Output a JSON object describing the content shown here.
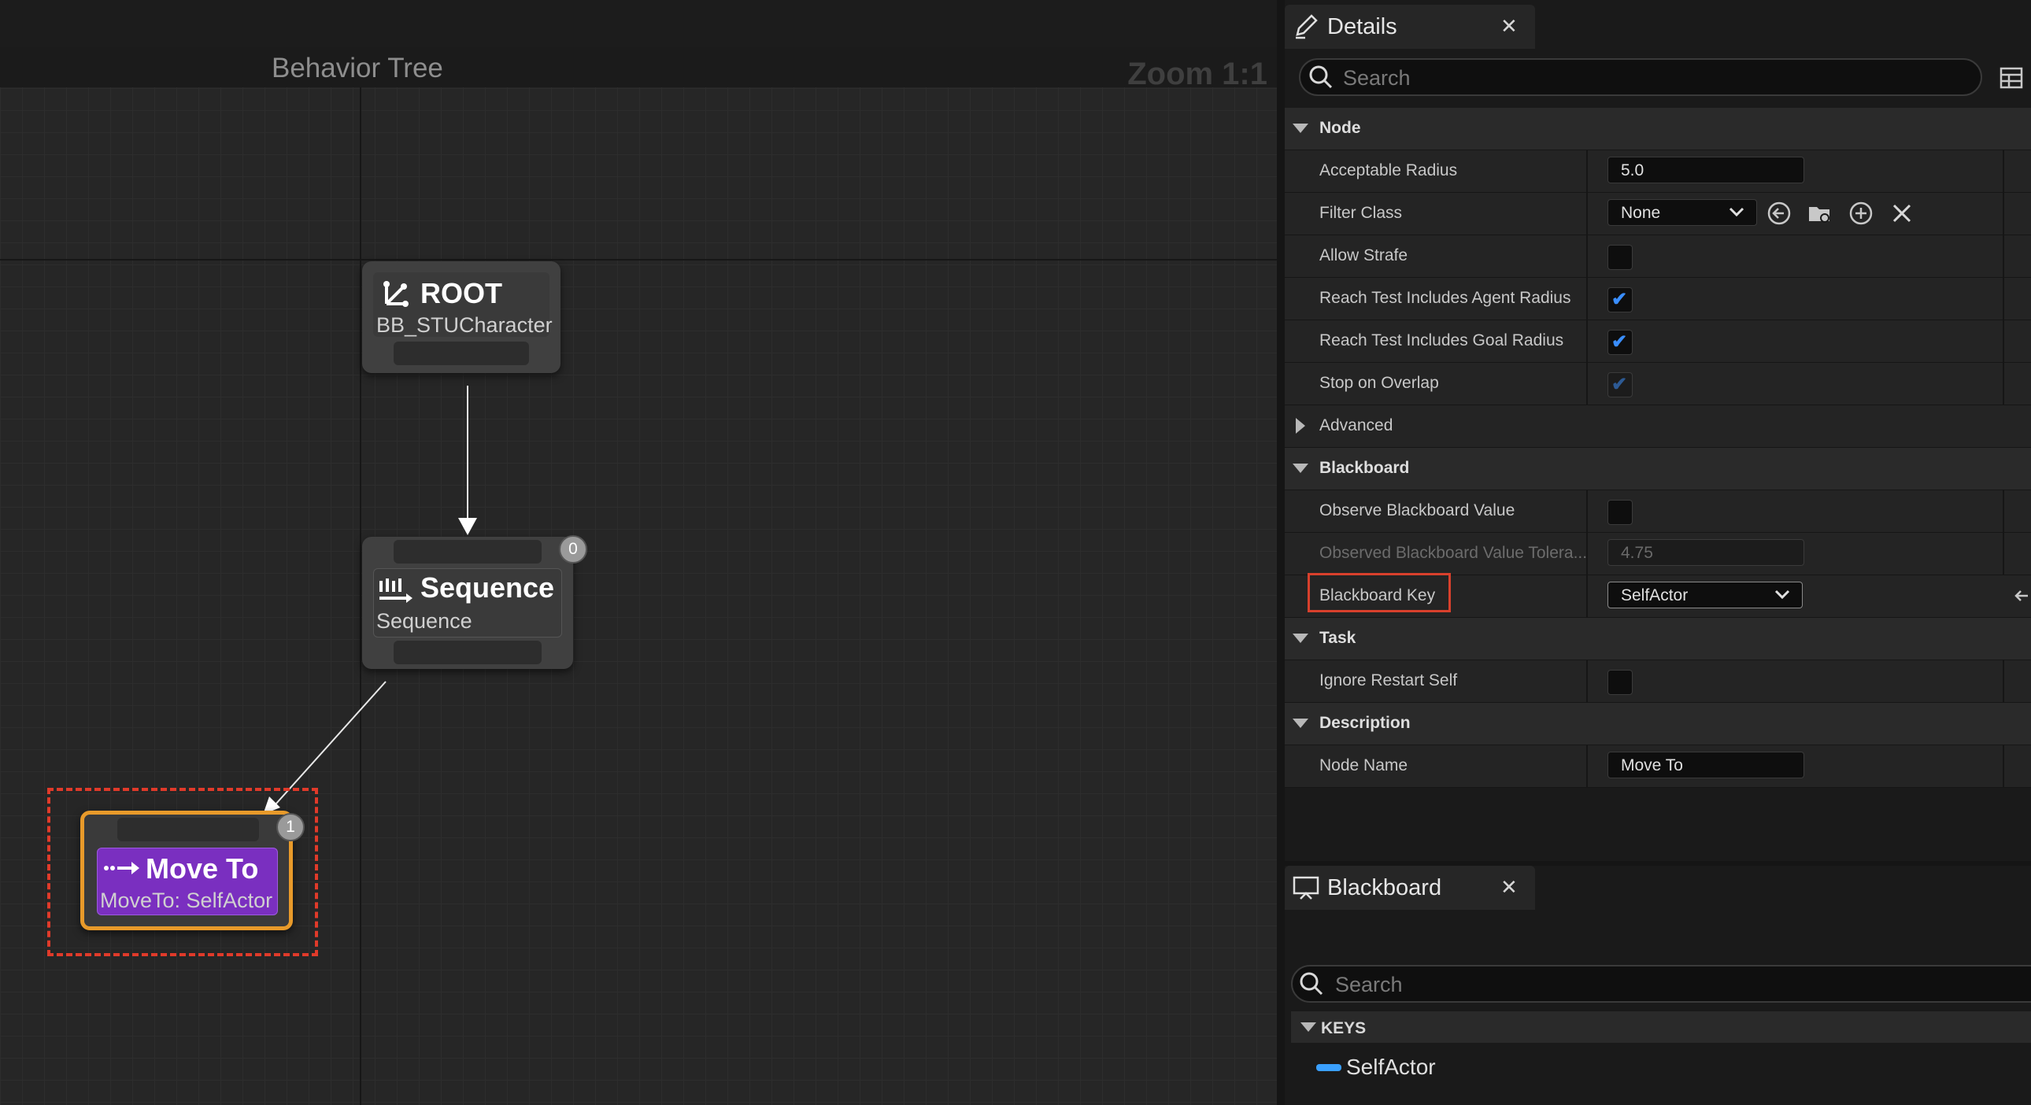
{
  "graph": {
    "title": "Behavior Tree",
    "zoom": "Zoom 1:1",
    "nodes": {
      "root": {
        "title": "ROOT",
        "subtitle": "BB_STUCharacter"
      },
      "sequence": {
        "title": "Sequence",
        "subtitle": "Sequence",
        "index": "0"
      },
      "move_to": {
        "title": "Move To",
        "subtitle": "MoveTo: SelfActor",
        "index": "1"
      }
    }
  },
  "details": {
    "tab_label": "Details",
    "search_placeholder": "Search",
    "categories": {
      "node": "Node",
      "advanced": "Advanced",
      "blackboard": "Blackboard",
      "task": "Task",
      "description": "Description"
    },
    "properties": {
      "acceptable_radius": {
        "label": "Acceptable Radius",
        "value": "5.0"
      },
      "filter_class": {
        "label": "Filter Class",
        "value": "None"
      },
      "allow_strafe": {
        "label": "Allow Strafe",
        "checked": false
      },
      "reach_agent_radius": {
        "label": "Reach Test Includes Agent Radius",
        "checked": true
      },
      "reach_goal_radius": {
        "label": "Reach Test Includes Goal Radius",
        "checked": true
      },
      "stop_on_overlap": {
        "label": "Stop on Overlap",
        "checked": true
      },
      "observe_bb_value": {
        "label": "Observe Blackboard Value",
        "checked": false
      },
      "observed_tolerance": {
        "label": "Observed Blackboard Value Tolera...",
        "value": "4.75"
      },
      "blackboard_key": {
        "label": "Blackboard Key",
        "value": "SelfActor"
      },
      "ignore_restart_self": {
        "label": "Ignore Restart Self",
        "checked": false
      },
      "node_name": {
        "label": "Node Name",
        "value": "Move To"
      }
    },
    "check_glyph": "✔"
  },
  "blackboard": {
    "tab_label": "Blackboard",
    "search_placeholder": "Search",
    "keys_header": "KEYS",
    "keys": [
      "SelfActor"
    ],
    "key_color": "#3aa0ff"
  },
  "colors": {
    "selection": "#e03a2a",
    "move_to_node": "#7a2fc0",
    "move_to_border": "#e89a2a",
    "check": "#3a8eff"
  },
  "icons": {
    "details_tab": "pencil-icon",
    "search": "search-icon",
    "grid_view": "table-icon",
    "use_selected": "arrow-left-circle-icon",
    "browse": "folder-search-icon",
    "add": "plus-circle-icon",
    "clear": "close-icon",
    "blackboard_tab": "monitor-icon",
    "close": "close-icon"
  }
}
